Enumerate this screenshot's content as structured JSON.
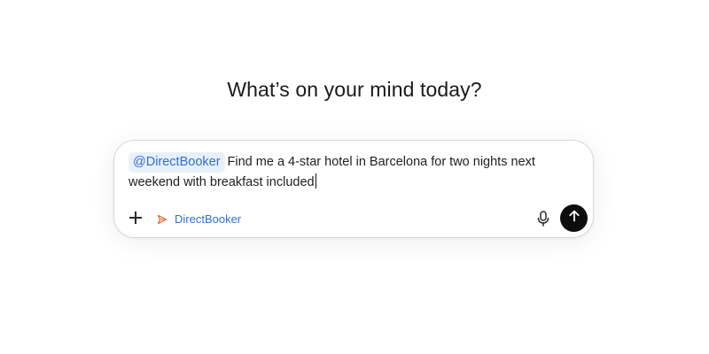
{
  "heading": "What’s on your mind today?",
  "composer": {
    "mention": "@DirectBooker",
    "prompt_text": "Find me a 4-star hotel in Barcelona for two nights next weekend with breakfast included",
    "agent_label": "DirectBooker",
    "icons": {
      "add": "plus-icon",
      "agent": "send-arrow-icon",
      "mic": "microphone-icon",
      "send": "arrow-up-icon"
    }
  },
  "colors": {
    "accent": "#2f6fd6",
    "chip_background": "#e8f0fb",
    "agent_icon": "#e0713c",
    "send_button": "#0d0d0d"
  }
}
